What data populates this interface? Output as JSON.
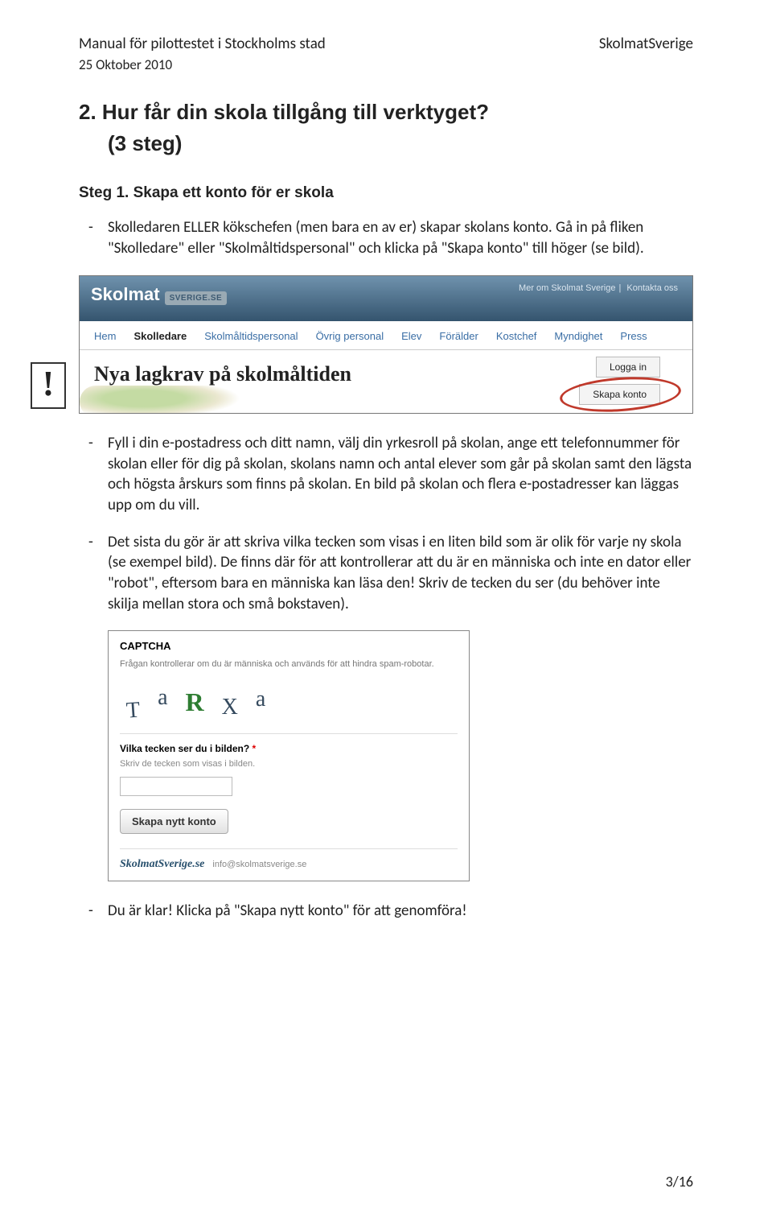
{
  "header": {
    "left_title": "Manual för pilottestet i Stockholms stad",
    "date": "25 Oktober 2010",
    "right": "SkolmatSverige"
  },
  "section": {
    "num_title": "2. Hur får din skola tillgång till verktyget?",
    "bracket": "(3 steg)",
    "step_title": "Steg 1. Skapa ett konto för er skola"
  },
  "para1": "Skolledaren ELLER kökschefen (men bara en av er) skapar skolans konto. Gå in på fliken \"Skolledare\" eller \"Skolmåltidspersonal\" och klicka på \"Skapa konto\" till höger (se bild).",
  "para2": "Fyll i din e-postadress och ditt namn, välj din yrkesroll på skolan, ange ett telefonnummer för skolan eller för dig på skolan, skolans namn och antal elever som går på skolan samt den lägsta och högsta årskurs som finns på skolan. En bild på skolan och flera e-postadresser kan läggas upp om du vill.",
  "para3": "Det sista du gör är att skriva vilka tecken som visas i en liten bild som är olik för varje ny skola (se exempel bild). De finns där för att kontrollerar att du är en människa och inte en dator eller \"robot\", eftersom bara en människa kan läsa den! Skriv de tecken du ser (du behöver inte skilja mellan stora och små bokstaven).",
  "para4": "Du är klar! Klicka på \"Skapa nytt konto\" för att genomföra!",
  "excl": "!",
  "shot1": {
    "brand": "Skolmat",
    "brand_tag": "SVERIGE.SE",
    "link1": "Mer om Skolmat Sverige",
    "link2": "Kontakta oss",
    "nav": [
      "Hem",
      "Skolledare",
      "Skolmåltidspersonal",
      "Övrig personal",
      "Elev",
      "Förälder",
      "Kostchef",
      "Myndighet",
      "Press"
    ],
    "nav_active_index": 1,
    "headline": "Nya lagkrav på skolmåltiden",
    "login": "Logga in",
    "create": "Skapa konto"
  },
  "shot2": {
    "title": "CAPTCHA",
    "desc": "Frågan kontrollerar om du är människa och används för att hindra spam-robotar.",
    "chars": [
      "T",
      "a",
      "R",
      "X",
      "a"
    ],
    "question": "Vilka tecken ser du i bilden?",
    "asterisk": "*",
    "hint": "Skriv de tecken som visas i bilden.",
    "button": "Skapa nytt konto",
    "footbrand": "SkolmatSverige.se",
    "footmail": "info@skolmatsverige.se"
  },
  "pagenum": "3/16"
}
